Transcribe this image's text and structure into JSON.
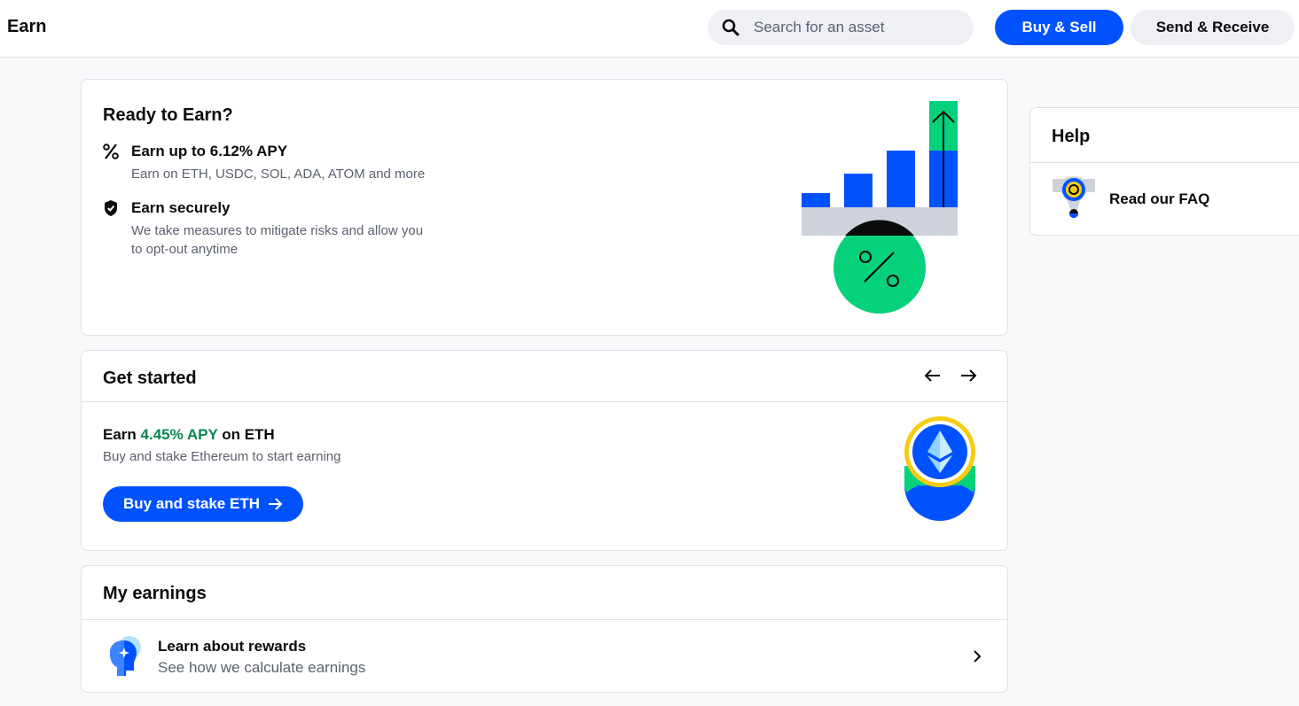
{
  "header": {
    "title": "Earn",
    "search_placeholder": "Search for an asset",
    "buy_sell_label": "Buy & Sell",
    "send_receive_label": "Send & Receive"
  },
  "ready_card": {
    "title": "Ready to Earn?",
    "features": [
      {
        "icon": "percent-icon",
        "title": "Earn up to 6.12% APY",
        "description": "Earn on ETH, USDC, SOL, ADA, ATOM and more"
      },
      {
        "icon": "shield-icon",
        "title": "Earn securely",
        "description": "We take measures to mitigate risks and allow you to opt-out anytime"
      }
    ]
  },
  "get_started": {
    "title": "Get started",
    "earn_prefix": "Earn ",
    "earn_apy": "4.45% APY",
    "earn_suffix": " on ETH",
    "description": "Buy and stake Ethereum to start earning",
    "button_label": "Buy and stake ETH"
  },
  "my_earnings": {
    "title": "My earnings",
    "item_title": "Learn about rewards",
    "item_description": "See how we calculate earnings"
  },
  "help": {
    "title": "Help",
    "faq_label": "Read our FAQ"
  },
  "colors": {
    "brand_blue": "#0052ff",
    "apy_green": "#098551",
    "illustration_green": "#05d17a",
    "illustration_yellow": "#f6cc12"
  }
}
